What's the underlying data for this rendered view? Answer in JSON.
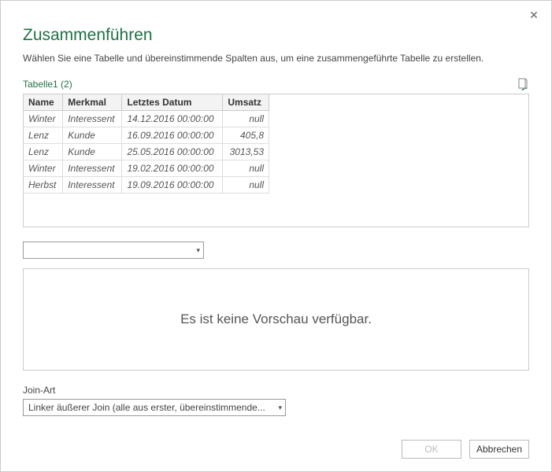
{
  "dialog": {
    "title": "Zusammenführen",
    "subtitle": "Wählen Sie eine Tabelle und übereinstimmende Spalten aus, um eine zusammengeführte Tabelle zu erstellen.",
    "tableName": "Tabelle1 (2)"
  },
  "columns": [
    "Name",
    "Merkmal",
    "Letztes Datum",
    "Umsatz"
  ],
  "rows": [
    {
      "c0": "Winter",
      "c1": "Interessent",
      "c2": "14.12.2016 00:00:00",
      "c3": "null"
    },
    {
      "c0": "Lenz",
      "c1": "Kunde",
      "c2": "16.09.2016 00:00:00",
      "c3": "405,8"
    },
    {
      "c0": "Lenz",
      "c1": "Kunde",
      "c2": "25.05.2016 00:00:00",
      "c3": "3013,53"
    },
    {
      "c0": "Winter",
      "c1": "Interessent",
      "c2": "19.02.2016 00:00:00",
      "c3": "null"
    },
    {
      "c0": "Herbst",
      "c1": "Interessent",
      "c2": "19.09.2016 00:00:00",
      "c3": "null"
    }
  ],
  "secondTable": {
    "selected": ""
  },
  "noPreview": "Es ist keine Vorschau verfügbar.",
  "join": {
    "label": "Join-Art",
    "selected": "Linker äußerer Join (alle aus erster, übereinstimmende..."
  },
  "buttons": {
    "ok": "OK",
    "cancel": "Abbrechen"
  }
}
